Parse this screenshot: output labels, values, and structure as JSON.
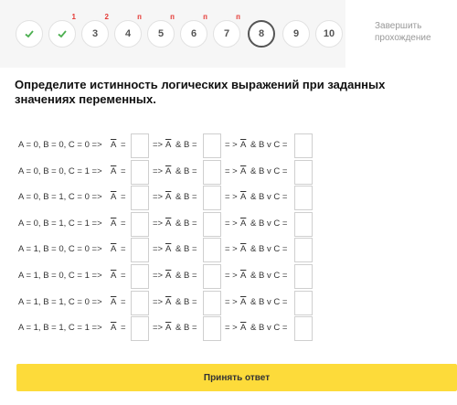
{
  "steps": [
    {
      "label": "",
      "icon": "check-icon",
      "sup": ""
    },
    {
      "label": "",
      "icon": "check-icon",
      "sup": "1"
    },
    {
      "label": "3",
      "sup": "2"
    },
    {
      "label": "4",
      "sup": "п"
    },
    {
      "label": "5",
      "sup": "п"
    },
    {
      "label": "6",
      "sup": "п"
    },
    {
      "label": "7",
      "sup": "п"
    },
    {
      "label": "8",
      "sup": "",
      "current": true
    },
    {
      "label": "9",
      "sup": ""
    },
    {
      "label": "10",
      "sup": ""
    }
  ],
  "finish": {
    "line1": "Завершить",
    "line2": "прохождение"
  },
  "question": {
    "title": "Определите истинность логических выражений при заданных значениях переменных."
  },
  "rows": [
    {
      "assign": "A = 0, B = 0, C = 0 =>"
    },
    {
      "assign": "A = 0, B = 0, C = 1 =>"
    },
    {
      "assign": "A = 0, B = 1, C = 0 =>"
    },
    {
      "assign": "A = 0, B = 1, C = 1 =>"
    },
    {
      "assign": "A = 1, B = 0, C = 0 =>"
    },
    {
      "assign": "A = 1, B = 0, C = 1 =>"
    },
    {
      "assign": "A = 1, B = 1, C = 0 =>"
    },
    {
      "assign": "A = 1, B = 1, C = 1 =>"
    }
  ],
  "expr": {
    "notA_var": "A",
    "eq": "=",
    "arrow": "=>",
    "and_b": "& B =",
    "arrow2": "= >",
    "and_b_or_c": "& B v C ="
  },
  "submit": {
    "label": "Принять ответ"
  },
  "colors": {
    "accent": "#fddb3a",
    "check": "#4caf50",
    "badge": "#e53935"
  }
}
